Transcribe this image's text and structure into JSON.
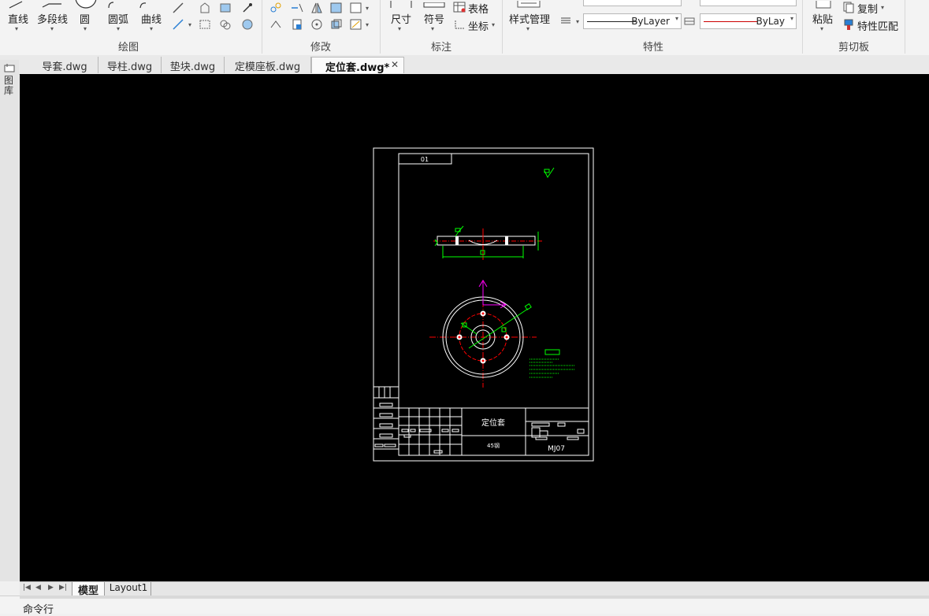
{
  "ribbon": {
    "draw_group": {
      "label": "绘图",
      "buttons": [
        "直线",
        "多段线",
        "圆",
        "圆弧",
        "曲线"
      ]
    },
    "modify_group": {
      "label": "修改"
    },
    "annotate_group": {
      "label": "标注",
      "dim_label": "尺寸",
      "symbol_label": "符号",
      "table_label": "表格",
      "coord_label": "坐标"
    },
    "style_button": "样式管理",
    "properties_group": {
      "label": "特性",
      "linetype_value": "ByLayer",
      "color_value": "ByLay"
    },
    "clipboard_group": {
      "label": "剪切板",
      "paste_label": "粘贴",
      "copy_label": "复制",
      "match_label": "特性匹配"
    }
  },
  "left_palette": {
    "label": "图库"
  },
  "doc_tabs": [
    {
      "label": "导套.dwg"
    },
    {
      "label": "导柱.dwg"
    },
    {
      "label": "垫块.dwg"
    },
    {
      "label": "定模座板.dwg"
    },
    {
      "label": "定位套.dwg*",
      "active": true
    }
  ],
  "drawing": {
    "drawing_no_box": "01",
    "title_block_name": "定位套",
    "material": "45钢",
    "code": "MJ07"
  },
  "layout_tabs": [
    "模型",
    "Layout1"
  ],
  "command_line": {
    "label": "命令行"
  },
  "colors": {
    "canvas": "#000000",
    "drawing_line": "#ffffff",
    "dimension": "#00ff00",
    "centerline": "#ff0000",
    "ucs": "#ff00ff"
  }
}
